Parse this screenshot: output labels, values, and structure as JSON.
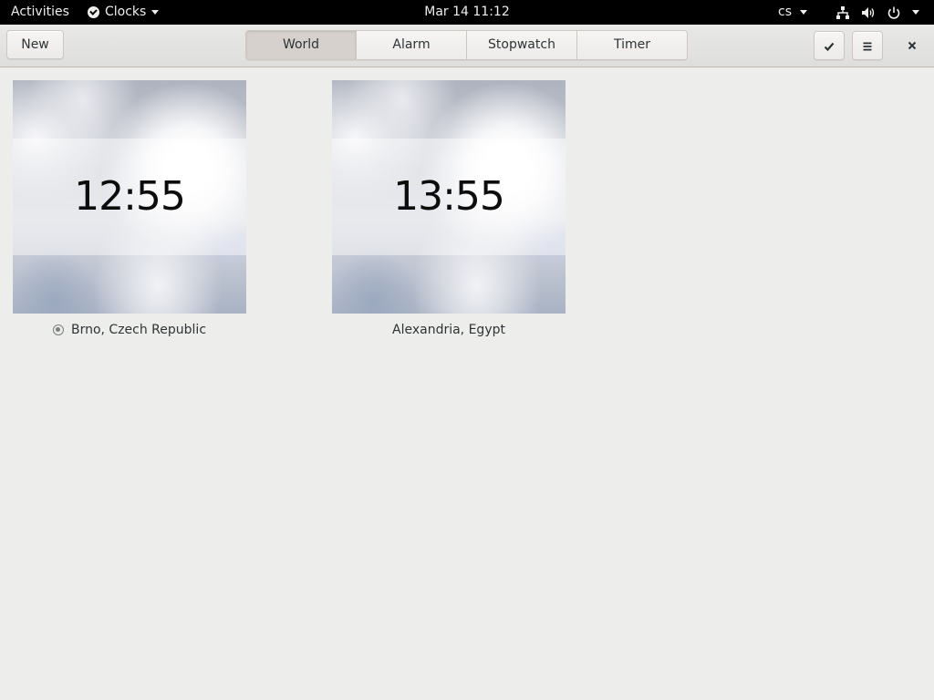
{
  "topbar": {
    "activities": "Activities",
    "app_name": "Clocks",
    "datetime": "Mar 14  11:12",
    "input_language": "cs",
    "icons": [
      "network-icon",
      "volume-icon",
      "power-icon"
    ]
  },
  "header": {
    "new_label": "New",
    "tabs": [
      {
        "label": "World",
        "active": true
      },
      {
        "label": "Alarm",
        "active": false
      },
      {
        "label": "Stopwatch",
        "active": false
      },
      {
        "label": "Timer",
        "active": false
      }
    ],
    "select_icon": "checkmark-icon",
    "menu_icon": "hamburger-menu-icon",
    "close_icon": "close-icon"
  },
  "world_clocks": [
    {
      "time": "12:55",
      "location": "Brno, Czech Republic",
      "is_current_location": true
    },
    {
      "time": "13:55",
      "location": "Alexandria, Egypt",
      "is_current_location": false
    }
  ]
}
